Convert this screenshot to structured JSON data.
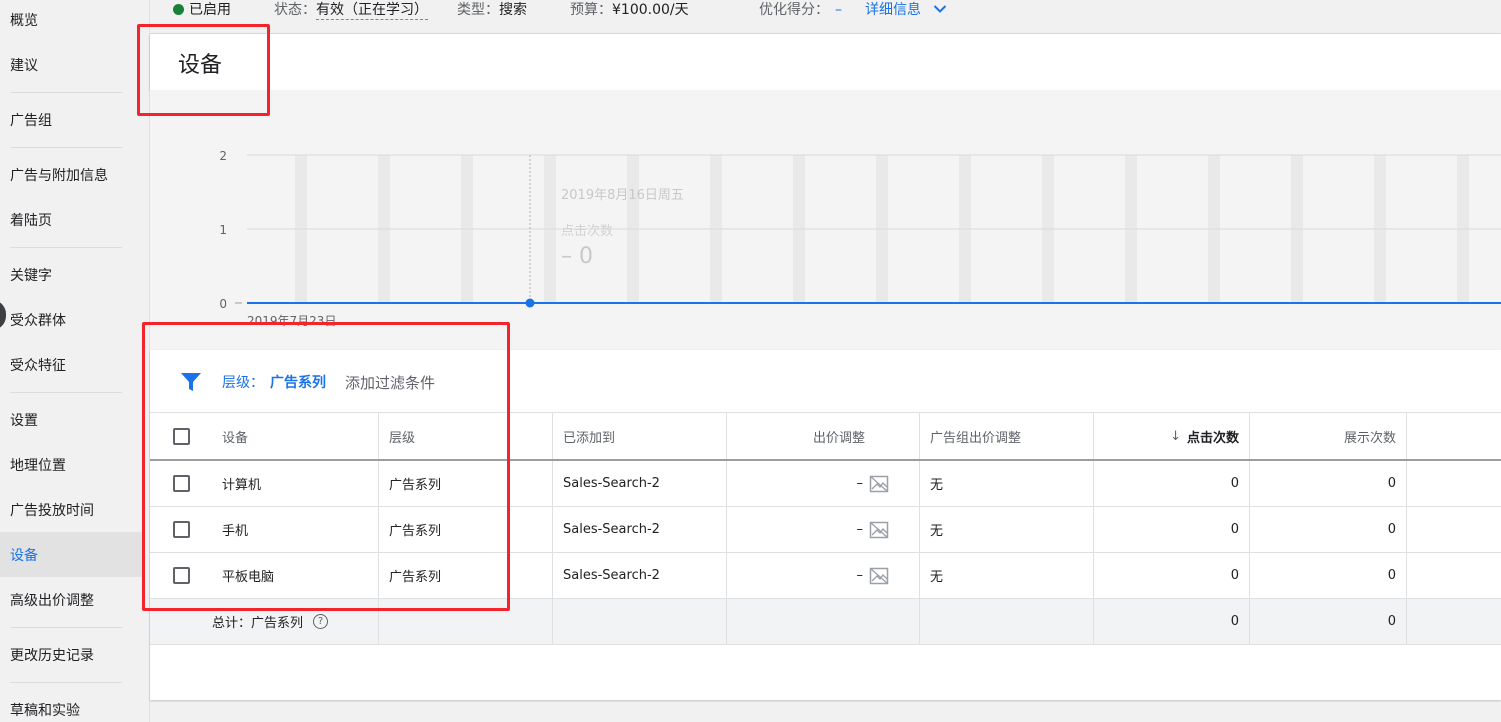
{
  "sidebar": {
    "items": [
      {
        "label": "概览"
      },
      {
        "label": "建议"
      },
      {
        "label": "广告组"
      },
      {
        "label": "广告与附加信息"
      },
      {
        "label": "着陆页"
      },
      {
        "label": "关键字"
      },
      {
        "label": "受众群体"
      },
      {
        "label": "受众特征"
      },
      {
        "label": "设置"
      },
      {
        "label": "地理位置"
      },
      {
        "label": "广告投放时间"
      },
      {
        "label": "设备"
      },
      {
        "label": "高级出价调整"
      },
      {
        "label": "更改历史记录"
      },
      {
        "label": "草稿和实验"
      }
    ],
    "active": "设备"
  },
  "topbar": {
    "enabled": "已启用",
    "status_label": "状态：",
    "status_value": "有效（正在学习）",
    "type_label": "类型：",
    "type_value": "搜索",
    "budget_label": "预算：",
    "budget_value": "¥100.00/天",
    "opt_label": "优化得分：",
    "opt_value": "–",
    "details": "详细信息"
  },
  "page_title": "设备",
  "chart": {
    "y_ticks": [
      "2",
      "1",
      "0"
    ],
    "start_date": "2019年7月23日",
    "tooltip": {
      "date": "2019年8月16日周五",
      "metric": "点击次数",
      "value": "– 0"
    },
    "colors": {
      "line": "#1a73e8",
      "bars": "#e9e9e9"
    }
  },
  "filter": {
    "label": "层级：",
    "value": "广告系列",
    "add": "添加过滤条件"
  },
  "table": {
    "columns": [
      "设备",
      "层级",
      "已添加到",
      "出价调整",
      "广告组出价调整",
      "点击次数",
      "展示次数"
    ],
    "rows": [
      {
        "device": "计算机",
        "level": "广告系列",
        "added_to": "Sales-Search-2",
        "bid_adj": "–",
        "adgroup_bid_adj": "无",
        "clicks": "0",
        "impressions": "0"
      },
      {
        "device": "手机",
        "level": "广告系列",
        "added_to": "Sales-Search-2",
        "bid_adj": "–",
        "adgroup_bid_adj": "无",
        "clicks": "0",
        "impressions": "0"
      },
      {
        "device": "平板电脑",
        "level": "广告系列",
        "added_to": "Sales-Search-2",
        "bid_adj": "–",
        "adgroup_bid_adj": "无",
        "clicks": "0",
        "impressions": "0"
      }
    ],
    "total": {
      "label": "总计：广告系列",
      "clicks": "0",
      "impressions": "0"
    }
  },
  "colors": {
    "accent": "#1a73e8",
    "status_green": "#188038",
    "annotation_red": "#f4242d"
  }
}
